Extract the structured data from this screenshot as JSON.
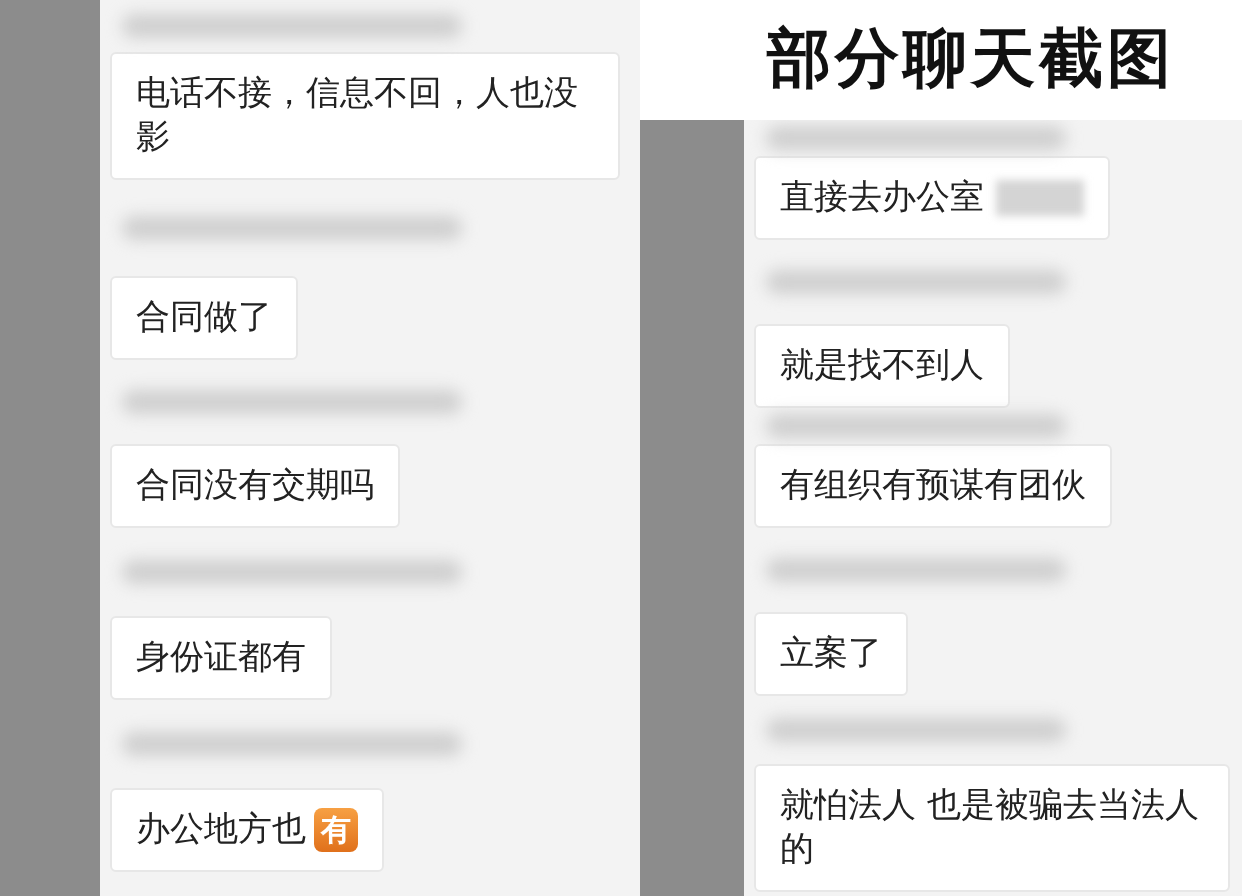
{
  "title": "部分聊天截图",
  "panels": [
    {
      "items": [
        {
          "kind": "blurred"
        },
        {
          "kind": "message",
          "text": "电话不接，信息不回，人也没影"
        },
        {
          "kind": "blurred"
        },
        {
          "kind": "message",
          "text": "合同做了"
        },
        {
          "kind": "blurred"
        },
        {
          "kind": "message",
          "text": "合同没有交期吗"
        },
        {
          "kind": "blurred"
        },
        {
          "kind": "message",
          "text": "身份证都有"
        },
        {
          "kind": "blurred"
        },
        {
          "kind": "message",
          "text": "办公地方也",
          "badge": "有"
        }
      ]
    },
    {
      "items": [
        {
          "kind": "blurred"
        },
        {
          "kind": "message",
          "text": "直接去办公室",
          "redacted": true
        },
        {
          "kind": "blurred"
        },
        {
          "kind": "message",
          "text": "就是找不到人"
        },
        {
          "kind": "blurred"
        },
        {
          "kind": "message",
          "text": "有组织有预谋有团伙"
        },
        {
          "kind": "blurred"
        },
        {
          "kind": "message",
          "text": "立案了"
        },
        {
          "kind": "blurred"
        },
        {
          "kind": "message",
          "text": "就怕法人 也是被骗去当法人的"
        }
      ]
    }
  ]
}
